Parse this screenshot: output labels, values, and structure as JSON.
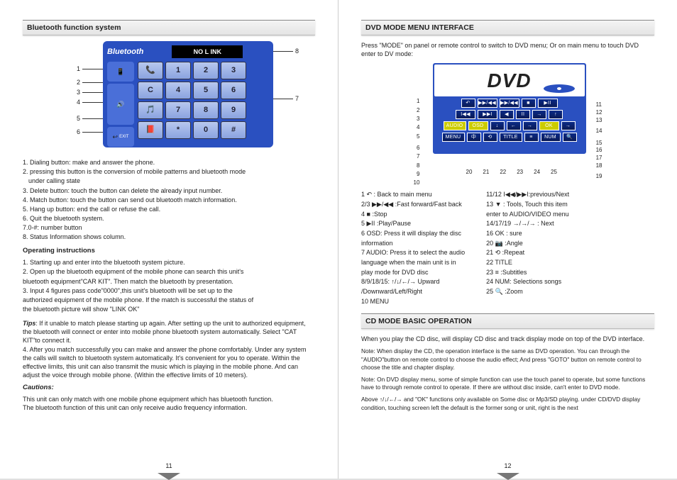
{
  "left": {
    "title": "Bluetooth   function system",
    "bt_title": "Bluetooth",
    "bt_status": "NO  L  INK",
    "keys": [
      "📞",
      "1",
      "2",
      "3",
      "C",
      "4",
      "5",
      "6",
      "🎵",
      "7",
      "8",
      "9",
      "📕",
      "*",
      "0",
      "#"
    ],
    "callouts_left": [
      "1",
      "2",
      "3",
      "4",
      "5",
      "6"
    ],
    "callouts_right": [
      "8",
      "7"
    ],
    "desc": [
      "1. Dialing button: make and answer the phone.",
      "2. pressing this button is the conversion of mobile patterns and bluetooth mode",
      "   under calling state",
      "3. Delete button: touch the button can delete the already input number.",
      "4. Match button: touch the button can send out bluetooth match information.",
      "5. Hang up button: end the call or refuse the call.",
      "6. Quit the bluetooth system.",
      "7.0-#: number button",
      "8. Status Information shows column."
    ],
    "op_head": "Operating instructions",
    "op": [
      "1. Starting up and enter into the bluetooth system picture.",
      "2. Open up the bluetooth equipment of the mobile phone can search this unit's",
      "bluetooth equipment\"CAR KIT\". Then match the bluetooth by presentation.",
      "3. Input 4 figures pass code\"0000\",this unit's bluetooth will be set up to the",
      "authorized equipment of the mobile phone. If the match is successful the status of",
      "the bluetooth picture will show \"LINK OK\""
    ],
    "tips_head": "Tips",
    "tips": ": If it unable to match please starting up again. After setting up the unit to authorized equipment, the bluetooth will connect or enter into mobile phone bluetooth system automatically. Select \"CAT KIT\"to connect it.\n4. After you match successfully you can make and answer the phone comfortably. Under any system the calls will switch to bluetooth system automatically. It's convenient for you to operate. Within the effective limits, this unit can also transmit the music which is playing in the mobile phone. And can adjust the voice through mobile phone. (Within the effective limits of 10 meters).",
    "caution_head": "Cautions:",
    "caution": "This unit can only match with one mobile phone equipment which has bluetooth function.\nThe bluetooth function of this unit can only receive audio frequency information.",
    "pgnum": "11"
  },
  "right": {
    "title1": "DVD MODE MENU INTERFACE",
    "intro": "Press \"MODE\" on panel or remote control to switch to DVD menu; Or on main menu to touch DVD enter to DV mode:",
    "dvd_logo": "DVD",
    "btn_rows": [
      [
        "↶",
        "▶▶/◀◀",
        "▶▶/◀◀",
        "■",
        "▶II"
      ],
      [
        "I◀◀",
        "▶▶I",
        "◀",
        "II",
        "→",
        "↑"
      ],
      [
        "AUDIO",
        "OSD",
        "↓",
        "←",
        "→",
        "OK",
        "→"
      ],
      [
        "MENU",
        "中",
        "⟲",
        "TITLE",
        "≡",
        "NUM",
        "🔍"
      ]
    ],
    "bottom_nums": [
      "20",
      "21",
      "22",
      "23",
      "24",
      "25"
    ],
    "left_nums": [
      "1",
      "2",
      "3",
      "4",
      "5",
      "6",
      "7",
      "8",
      "9",
      "10"
    ],
    "right_nums": [
      "11",
      "12",
      "13",
      "14",
      "15",
      "16",
      "17",
      "18",
      "19"
    ],
    "legend_left": [
      "1 ↶ : Back to main menu",
      "2/3  ▶▶/◀◀ :Fast forward/Fast back",
      "4  ■  :Stop",
      "5  ▶II :Play/Pause",
      "6 OSD: Press it will display the disc",
      "   information",
      "7 AUDIO: Press it to select the audio",
      "   language when the main unit is in",
      "   play mode for DVD disc",
      "8/9/18/15: ↑/↓/←/→ Upward",
      "   /Downward/Left/Right",
      "10 MENU"
    ],
    "legend_right": [
      "11/12  I◀◀/▶▶I:previous/Next",
      "13 ▼ : Tools, Touch this item",
      "   enter to AUDIO/VIDEO menu",
      "14/17/19  →/→/→ : Next",
      "16 OK : sure",
      "20 📷 :Angle",
      "21 ⟲ :Repeat",
      "22 TITLE",
      "23 ≡ :Subtitles",
      "24 NUM: Selections songs",
      "25 🔍 :Zoom"
    ],
    "title2": "CD MODE BASIC  OPERATION",
    "cd_intro": "When you play the CD disc, will display CD disc and track display mode on top of the DVD interface.",
    "cd_notes": [
      "Note: When display the CD, the operation interface is the same as DVD operation. You can through the \"AUDIO\"button on remote control to choose the audio effect; And press \"GOTO\" button on remote control to choose the title and chapter display.",
      "Note: On DVD display menu, some of simple function can use the touch panel to operate, but some functions have to through remote control to operate. If there are without disc inside, can't enter to DVD mode.",
      "Above ↑/↓/←/→ and \"OK\" functions only available on Some disc or Mp3/SD playing. under CD/DVD display condition, touching screen left the default is the former song or unit, right is the next"
    ],
    "pgnum": "12"
  }
}
